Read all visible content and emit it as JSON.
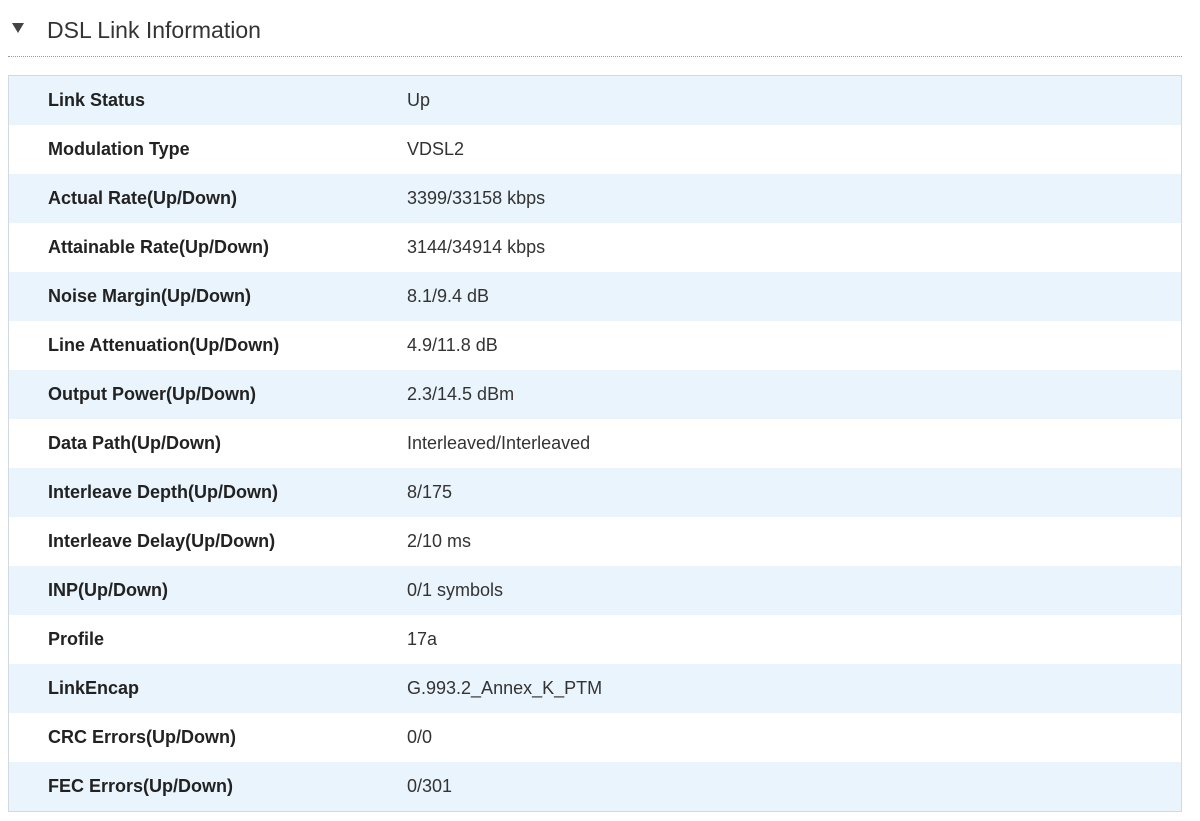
{
  "section": {
    "title": "DSL Link Information",
    "toggle_icon": "triangle-down-icon"
  },
  "rows": [
    {
      "label": "Link Status",
      "value": "Up"
    },
    {
      "label": "Modulation Type",
      "value": "VDSL2"
    },
    {
      "label": "Actual Rate(Up/Down)",
      "value": "3399/33158 kbps"
    },
    {
      "label": "Attainable Rate(Up/Down)",
      "value": "3144/34914 kbps"
    },
    {
      "label": "Noise Margin(Up/Down)",
      "value": "8.1/9.4 dB"
    },
    {
      "label": "Line Attenuation(Up/Down)",
      "value": "4.9/11.8 dB"
    },
    {
      "label": "Output Power(Up/Down)",
      "value": "2.3/14.5 dBm"
    },
    {
      "label": "Data Path(Up/Down)",
      "value": "Interleaved/Interleaved"
    },
    {
      "label": "Interleave Depth(Up/Down)",
      "value": "8/175"
    },
    {
      "label": "Interleave Delay(Up/Down)",
      "value": "2/10 ms"
    },
    {
      "label": "INP(Up/Down)",
      "value": "0/1 symbols"
    },
    {
      "label": "Profile",
      "value": "17a"
    },
    {
      "label": "LinkEncap",
      "value": "G.993.2_Annex_K_PTM"
    },
    {
      "label": "CRC Errors(Up/Down)",
      "value": "0/0"
    },
    {
      "label": "FEC Errors(Up/Down)",
      "value": "0/301"
    }
  ],
  "colors": {
    "row_stripe": "#eaf4fc",
    "row_plain": "#ffffff",
    "text": "#333333",
    "border": "#d3d9e0"
  }
}
